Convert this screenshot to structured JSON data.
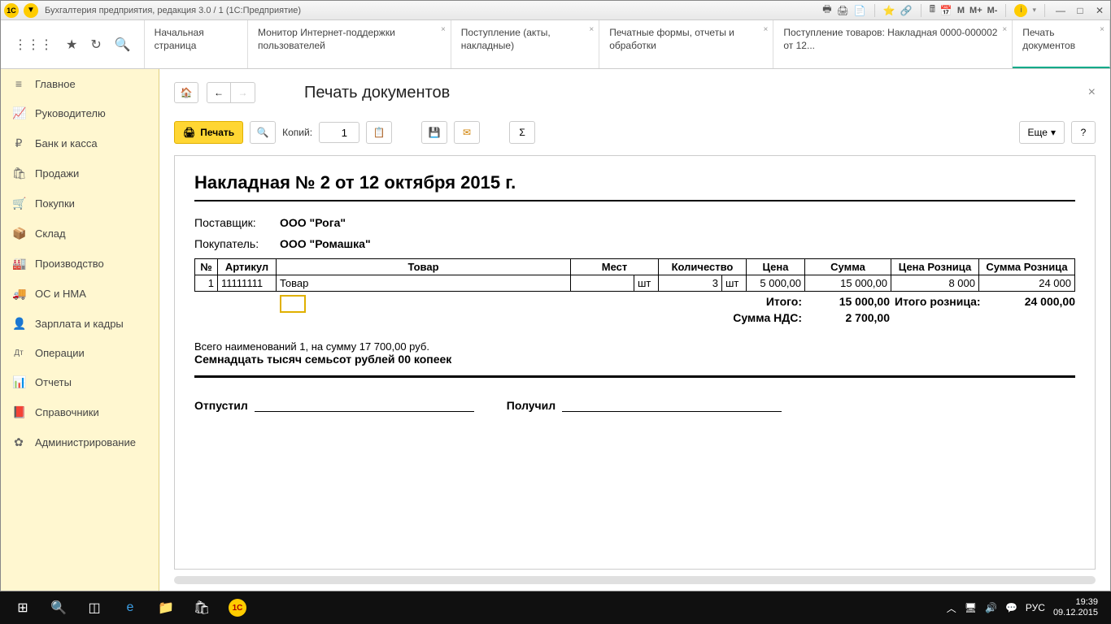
{
  "window": {
    "title": "Бухгалтерия предприятия, редакция 3.0 / 1  (1С:Предприятие)"
  },
  "titlebar_buttons": {
    "m": "M",
    "mplus": "M+",
    "mminus": "M-"
  },
  "tabs": [
    {
      "label": "Начальная страница",
      "closable": false
    },
    {
      "label": "Монитор Интернет-поддержки пользователей",
      "closable": true
    },
    {
      "label": "Поступление (акты, накладные)",
      "closable": true
    },
    {
      "label": "Печатные формы, отчеты и обработки",
      "closable": true
    },
    {
      "label": "Поступление товаров: Накладная 0000-000002 от 12...",
      "closable": true
    },
    {
      "label": "Печать документов",
      "closable": true,
      "active": true
    }
  ],
  "sidebar": [
    {
      "icon": "≡",
      "label": "Главное"
    },
    {
      "icon": "📈",
      "label": "Руководителю"
    },
    {
      "icon": "₽",
      "label": "Банк и касса"
    },
    {
      "icon": "🛍",
      "label": "Продажи"
    },
    {
      "icon": "🛒",
      "label": "Покупки"
    },
    {
      "icon": "📦",
      "label": "Склад"
    },
    {
      "icon": "🏭",
      "label": "Производство"
    },
    {
      "icon": "🚚",
      "label": "ОС и НМА"
    },
    {
      "icon": "👤",
      "label": "Зарплата и кадры"
    },
    {
      "icon": "Дт",
      "label": "Операции"
    },
    {
      "icon": "📊",
      "label": "Отчеты"
    },
    {
      "icon": "📕",
      "label": "Справочники"
    },
    {
      "icon": "✿",
      "label": "Администрирование"
    }
  ],
  "content": {
    "title": "Печать документов",
    "print_label": "Печать",
    "copies_label": "Копий:",
    "copies_value": "1",
    "more_label": "Еще",
    "help_label": "?"
  },
  "document": {
    "title": "Накладная № 2 от 12 октября 2015 г.",
    "supplier_label": "Поставщик:",
    "supplier": "ООО \"Рога\"",
    "buyer_label": "Покупатель:",
    "buyer": "ООО \"Ромашка\"",
    "headers": [
      "№",
      "Артикул",
      "Товар",
      "Мест",
      "Количество",
      "Цена",
      "Сумма",
      "Цена Розница",
      "Сумма Розница"
    ],
    "row": {
      "n": "1",
      "art": "11111111",
      "name": "Товар",
      "mest": "",
      "mest_unit": "шт",
      "qty": "3",
      "qty_unit": "шт",
      "price": "5 000,00",
      "sum": "15 000,00",
      "rprice": "8 000",
      "rsum": "24 000"
    },
    "totals": {
      "itogo_label": "Итого:",
      "itogo": "15 000,00",
      "nds_label": "Сумма НДС:",
      "nds": "2 700,00",
      "rozn_label": "Итого розница:",
      "rozn": "24 000,00"
    },
    "summary1": "Всего наименований 1, на сумму 17 700,00 руб.",
    "summary2": "Семнадцать тысяч семьсот рублей 00 копеек",
    "released": "Отпустил",
    "received": "Получил"
  },
  "taskbar": {
    "lang": "РУС",
    "time": "19:39",
    "date": "09.12.2015"
  }
}
